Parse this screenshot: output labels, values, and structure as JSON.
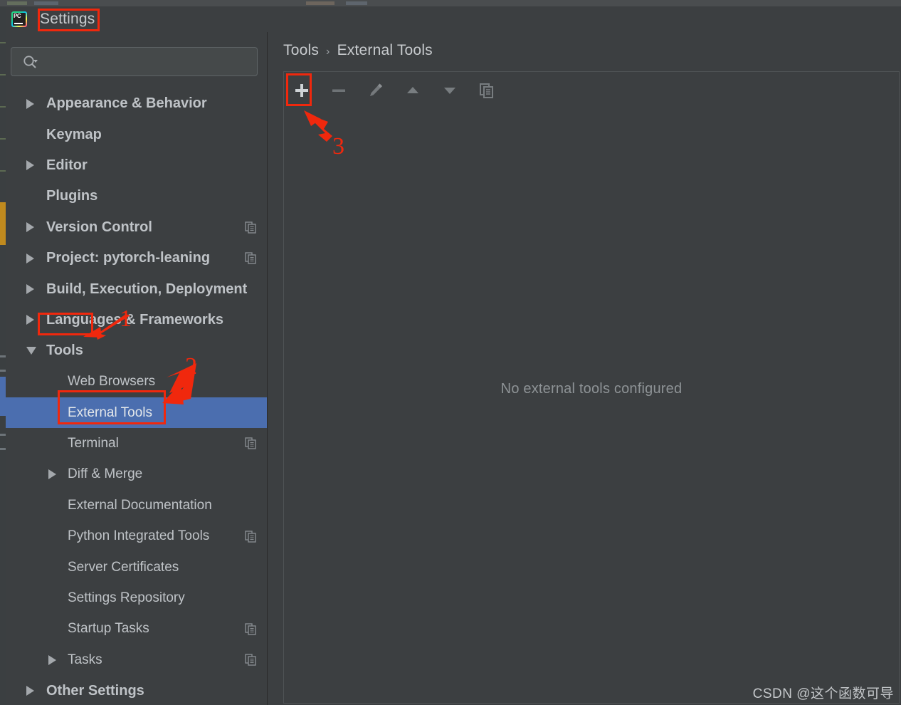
{
  "window": {
    "title": "Settings",
    "logo_icon": "pycharm-logo-icon"
  },
  "search": {
    "value": "",
    "placeholder": "",
    "icon": "search-icon",
    "dropdown_icon": "chevron-down-icon"
  },
  "sidebar": {
    "items": [
      {
        "label": "Appearance & Behavior",
        "level": 0,
        "arrow": "collapsed",
        "badge": false,
        "selected": false
      },
      {
        "label": "Keymap",
        "level": 0,
        "arrow": "none",
        "badge": false,
        "selected": false
      },
      {
        "label": "Editor",
        "level": 0,
        "arrow": "collapsed",
        "badge": false,
        "selected": false
      },
      {
        "label": "Plugins",
        "level": 0,
        "arrow": "none",
        "badge": false,
        "selected": false
      },
      {
        "label": "Version Control",
        "level": 0,
        "arrow": "collapsed",
        "badge": true,
        "selected": false
      },
      {
        "label": "Project: pytorch-leaning",
        "level": 0,
        "arrow": "collapsed",
        "badge": true,
        "selected": false
      },
      {
        "label": "Build, Execution, Deployment",
        "level": 0,
        "arrow": "collapsed",
        "badge": false,
        "selected": false
      },
      {
        "label": "Languages & Frameworks",
        "level": 0,
        "arrow": "collapsed",
        "badge": false,
        "selected": false
      },
      {
        "label": "Tools",
        "level": 0,
        "arrow": "expanded",
        "badge": false,
        "selected": false
      },
      {
        "label": "Web Browsers",
        "level": 1,
        "arrow": "none",
        "badge": false,
        "selected": false
      },
      {
        "label": "External Tools",
        "level": 1,
        "arrow": "none",
        "badge": false,
        "selected": true
      },
      {
        "label": "Terminal",
        "level": 1,
        "arrow": "none",
        "badge": true,
        "selected": false
      },
      {
        "label": "Diff & Merge",
        "level": 1,
        "arrow": "collapsed",
        "badge": false,
        "selected": false
      },
      {
        "label": "External Documentation",
        "level": 1,
        "arrow": "none",
        "badge": false,
        "selected": false
      },
      {
        "label": "Python Integrated Tools",
        "level": 1,
        "arrow": "none",
        "badge": true,
        "selected": false
      },
      {
        "label": "Server Certificates",
        "level": 1,
        "arrow": "none",
        "badge": false,
        "selected": false
      },
      {
        "label": "Settings Repository",
        "level": 1,
        "arrow": "none",
        "badge": false,
        "selected": false
      },
      {
        "label": "Startup Tasks",
        "level": 1,
        "arrow": "none",
        "badge": true,
        "selected": false
      },
      {
        "label": "Tasks",
        "level": 1,
        "arrow": "collapsed",
        "badge": true,
        "selected": false
      },
      {
        "label": "Other Settings",
        "level": 0,
        "arrow": "collapsed",
        "badge": false,
        "selected": false
      }
    ]
  },
  "main": {
    "breadcrumb": {
      "parent": "Tools",
      "separator": "›",
      "current": "External Tools"
    },
    "toolbar": [
      {
        "name": "add-button",
        "icon": "plus-icon",
        "enabled": true,
        "highlighted": true
      },
      {
        "name": "remove-button",
        "icon": "minus-icon",
        "enabled": false,
        "highlighted": false
      },
      {
        "name": "edit-button",
        "icon": "pencil-icon",
        "enabled": false,
        "highlighted": false
      },
      {
        "name": "move-up-button",
        "icon": "arrow-up-icon",
        "enabled": false,
        "highlighted": false
      },
      {
        "name": "move-down-button",
        "icon": "arrow-down-icon",
        "enabled": false,
        "highlighted": false
      },
      {
        "name": "copy-button",
        "icon": "copy-icon",
        "enabled": false,
        "highlighted": false
      }
    ],
    "empty_message": "No external tools configured"
  },
  "annotations": {
    "numbers": [
      "1",
      "2",
      "3"
    ],
    "color": "#f0280d"
  },
  "watermark": "CSDN @这个函数可导",
  "colors": {
    "background": "#3c3f41",
    "selection": "#4b6eaf",
    "text": "#bfc3c7",
    "muted_text": "#8e9396",
    "annotation": "#f0280d"
  }
}
